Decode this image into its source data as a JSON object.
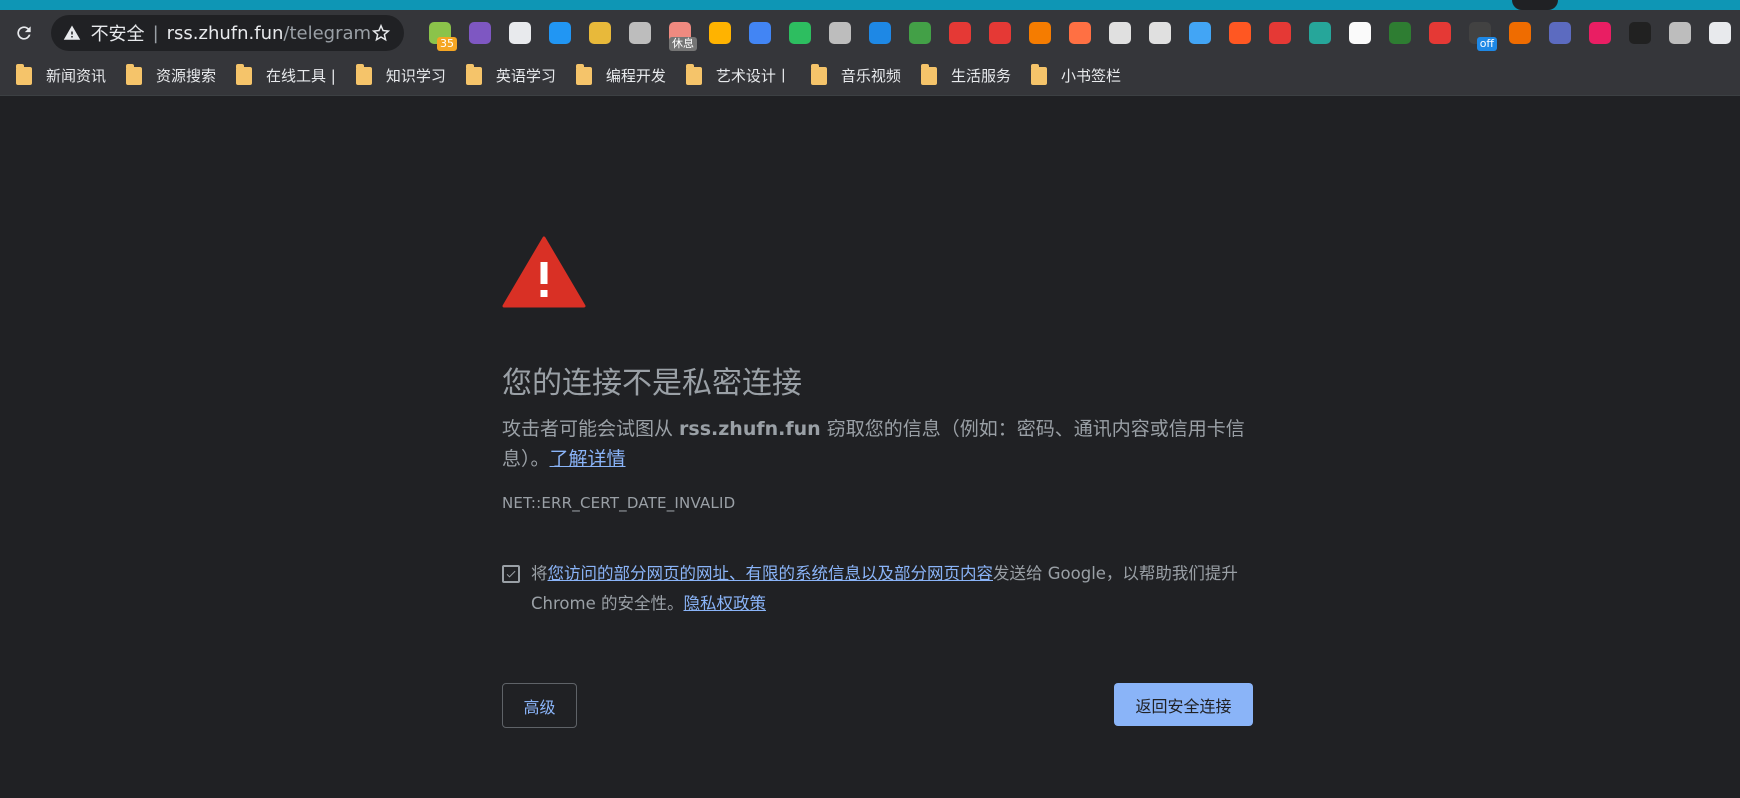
{
  "omnibox": {
    "security_label": "不安全",
    "url_host": "rss.zhufn.fun",
    "url_path": "/telegram..."
  },
  "extensions": [
    {
      "icon": "frog-icon",
      "badge": "35",
      "color": "#8bc34a",
      "badge_color": "#f5a623"
    },
    {
      "icon": "purple-cube-icon",
      "color": "#7e57c2"
    },
    {
      "icon": "scissors-icon",
      "color": "#e8eaed"
    },
    {
      "icon": "bolt-icon",
      "color": "#2196f3"
    },
    {
      "icon": "picture-icon",
      "color": "#e8b93a"
    },
    {
      "icon": "pin-icon",
      "color": "#bdbdbd"
    },
    {
      "icon": "rest-timer-icon",
      "badge": "休息",
      "color": "#ef8a80",
      "badge_color": "#757575"
    },
    {
      "icon": "check-circle-icon",
      "color": "#ffb300"
    },
    {
      "icon": "translate-icon",
      "color": "#4285f4"
    },
    {
      "icon": "evernote-icon",
      "color": "#2dbe60"
    },
    {
      "icon": "shield-icon",
      "color": "#bdbdbd"
    },
    {
      "icon": "signal-icon",
      "color": "#1e88e5"
    },
    {
      "icon": "globe-icon",
      "color": "#43a047"
    },
    {
      "icon": "medical-cross-icon",
      "color": "#e53935"
    },
    {
      "icon": "chart-circle-icon",
      "color": "#e53935"
    },
    {
      "icon": "rss-icon",
      "color": "#f57c00"
    },
    {
      "icon": "orange-app-icon",
      "color": "#ff7043"
    },
    {
      "icon": "owl-icon",
      "color": "#e0e0e0"
    },
    {
      "icon": "speedometer-icon",
      "color": "#e0e0e0"
    },
    {
      "icon": "diamond-icon",
      "color": "#42a5f5"
    },
    {
      "icon": "infinity-icon",
      "color": "#ff5722"
    },
    {
      "icon": "flash-icon",
      "color": "#e53935"
    },
    {
      "icon": "color-ring-icon",
      "color": "#26a69a"
    },
    {
      "icon": "i-icon",
      "color": "#fafafa"
    },
    {
      "icon": "green-card-icon",
      "color": "#2e7d32"
    },
    {
      "icon": "no-flash-icon",
      "color": "#e53935"
    },
    {
      "icon": "off-toggle-icon",
      "badge": "off",
      "color": "#424242",
      "badge_color": "#1e88e5"
    },
    {
      "icon": "glasses-icon",
      "color": "#ef6c00"
    },
    {
      "icon": "du-house-icon",
      "color": "#5c6bc0"
    },
    {
      "icon": "gu-icon",
      "color": "#e91e63"
    },
    {
      "icon": "l-icon",
      "color": "#212121"
    },
    {
      "icon": "cloud-download-icon",
      "color": "#bdbdbd"
    },
    {
      "icon": "puzzle-icon",
      "color": "#e8eaed"
    }
  ],
  "bookmarks": [
    "新闻资讯",
    "资源搜索",
    "在线工具 |",
    "知识学习",
    "英语学习",
    "编程开发",
    "艺术设计丨",
    "音乐视频",
    "生活服务",
    "小书签栏"
  ],
  "page": {
    "heading": "您的连接不是私密连接",
    "para_prefix": "攻击者可能会试图从 ",
    "para_host": "rss.zhufn.fun",
    "para_suffix": " 窃取您的信息（例如：密码、通讯内容或信用卡信息）。",
    "learn_more": "了解详情",
    "error_code": "NET::ERR_CERT_DATE_INVALID",
    "report_prefix": "将",
    "report_link": "您访问的部分网页的网址、有限的系统信息以及部分网页内容",
    "report_suffix": "发送给 Google，以帮助我们提升 Chrome 的安全性。",
    "privacy_link": "隐私权政策",
    "advanced_button": "高级",
    "back_button": "返回安全连接"
  }
}
